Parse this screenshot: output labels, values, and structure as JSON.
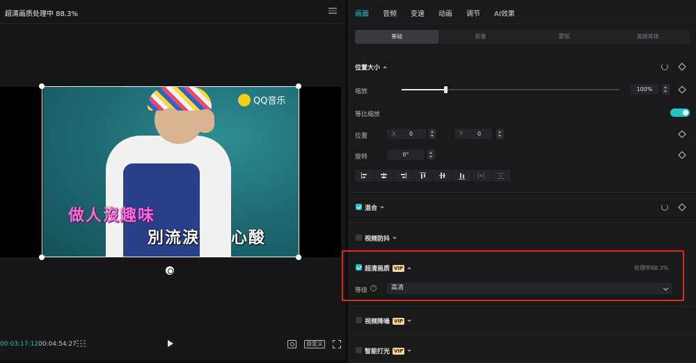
{
  "preview": {
    "title": "超清画质处理中 88.3%",
    "watermark": "QQ音乐",
    "lyrics": [
      "做人沒趣味",
      "別流淚",
      "心酸"
    ],
    "time_current": "00:03:17:12",
    "time_total": "00:04:54:27",
    "ratio_label": "自定义"
  },
  "tabs": [
    {
      "label": "画面",
      "active": true
    },
    {
      "label": "音频"
    },
    {
      "label": "变速"
    },
    {
      "label": "动画"
    },
    {
      "label": "调节"
    },
    {
      "label": "AI效果"
    }
  ],
  "subtabs": [
    {
      "label": "基础",
      "active": true
    },
    {
      "label": "抠像"
    },
    {
      "label": "蒙版"
    },
    {
      "label": "美颜美体"
    }
  ],
  "position_size": {
    "title": "位置大小",
    "scale_label": "缩放",
    "scale_value": "100%",
    "scale_slider_fraction": 0.2,
    "uniform_scale_label": "等比缩放",
    "uniform_scale_on": true,
    "position_label": "位置",
    "x_tag": "X",
    "x_value": "0",
    "y_tag": "Y",
    "y_value": "0",
    "rotate_label": "旋转",
    "rotate_value": "0°"
  },
  "blend": {
    "label": "混合",
    "checked": true
  },
  "stabilize": {
    "label": "视频防抖",
    "checked": false
  },
  "super_res": {
    "label": "超清画质",
    "vip": "VIP",
    "checked": true,
    "status": "处理中88.3%",
    "level_label": "等级",
    "level_value": "高清"
  },
  "denoise": {
    "label": "视频降噪",
    "vip": "VIP",
    "checked": false
  },
  "relight": {
    "label": "智能打光",
    "vip": "VIP",
    "checked": false
  },
  "colors": {
    "accent": "#20c4cb",
    "highlight": "#e4291e",
    "vip_gold": "#f6d39b"
  }
}
